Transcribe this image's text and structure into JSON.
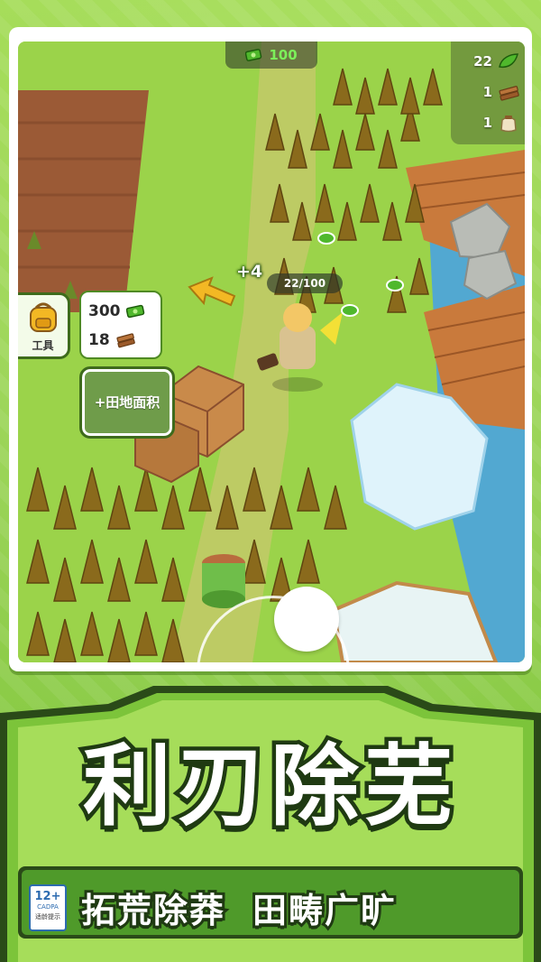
{
  "hud": {
    "money": "100",
    "resources": [
      {
        "count": "22",
        "icon": "leaf-icon"
      },
      {
        "count": "1",
        "icon": "wood-plank-icon"
      },
      {
        "count": "1",
        "icon": "sack-icon"
      }
    ]
  },
  "tool_button": {
    "label": "工具",
    "icon": "backpack-icon"
  },
  "cost_bubble": {
    "money_cost": "300",
    "wood_cost": "18"
  },
  "expand_button": {
    "label": "+田地面积"
  },
  "harvest": {
    "gain": "+4",
    "capacity": "22/100"
  },
  "banner": {
    "headline": "利刃除芜",
    "subtitle_left": "拓荒除莽",
    "subtitle_right": "田畴广旷",
    "age_rating": "12+",
    "age_org": "CADPA",
    "age_note": "适龄提示"
  },
  "colors": {
    "grass": "#9bd34a",
    "soil": "#9b5a36",
    "crop": "#8a6a1c",
    "water": "#4aa3e0",
    "outline": "#1f3a12",
    "accent_green": "#4fb82c"
  }
}
